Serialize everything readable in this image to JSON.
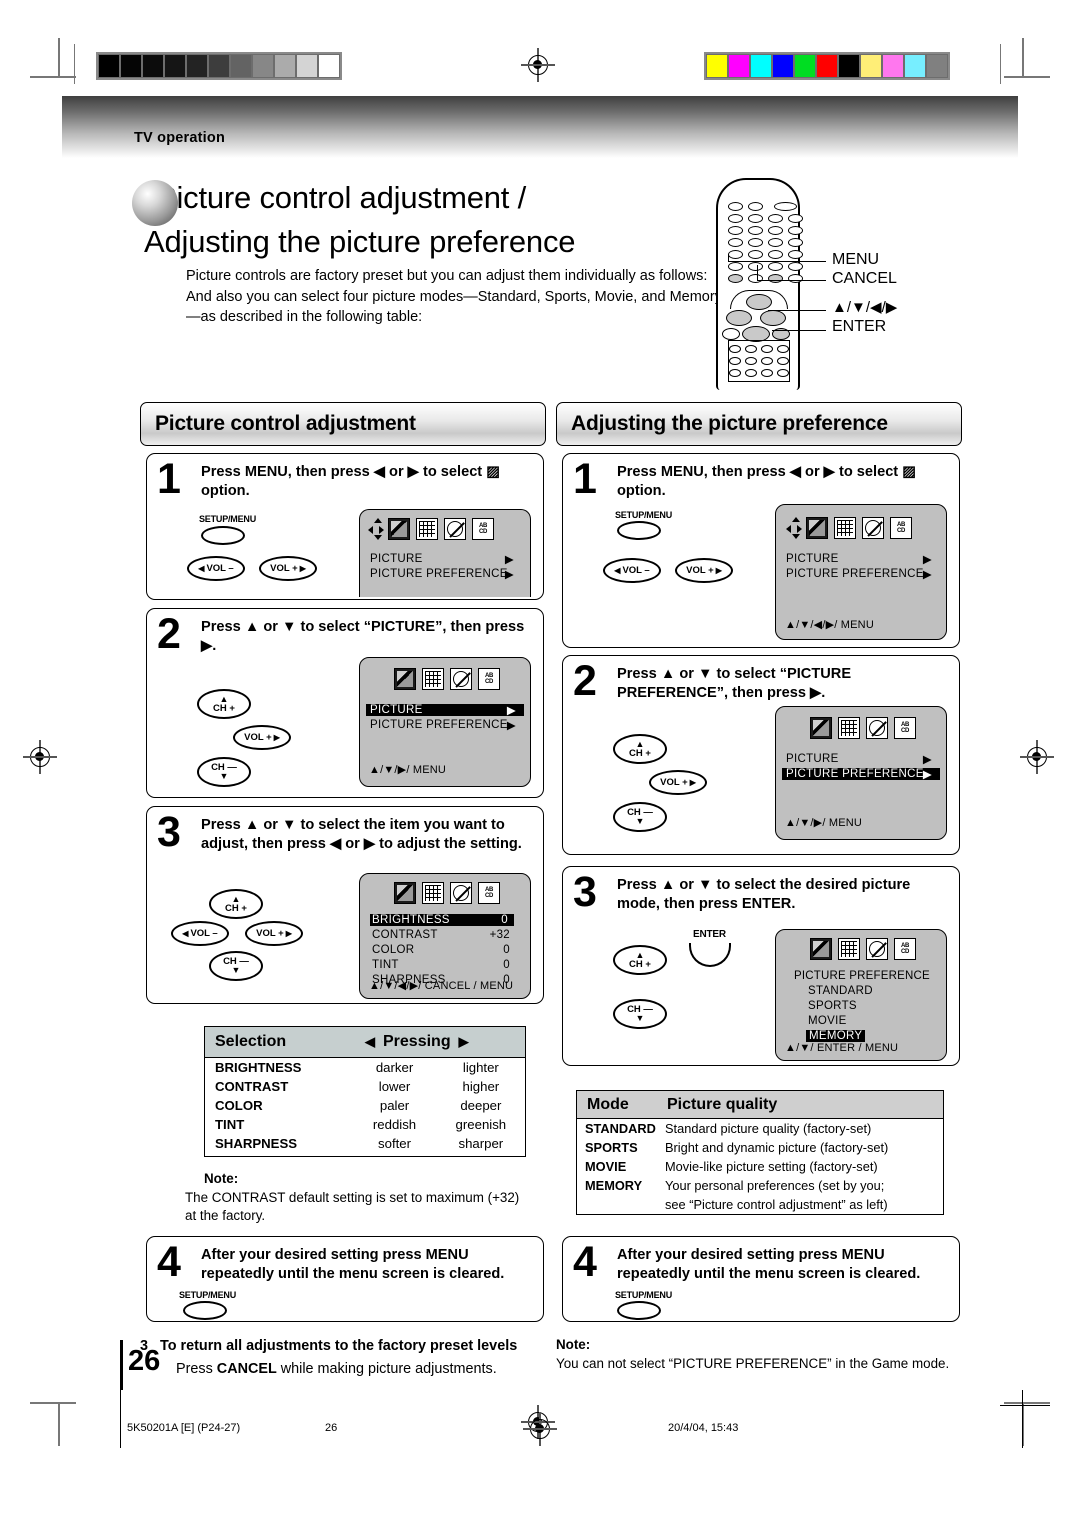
{
  "header": {
    "section_label": "TV operation"
  },
  "title": {
    "line1": "Picture control adjustment /",
    "line2": "Adjusting the picture preference"
  },
  "intro": "Picture controls are factory preset but you can adjust them individually as follows: And also you can select four picture modes—Standard, Sports, Movie, and Memory—as described in the following table:",
  "remote_callouts": {
    "menu": "MENU",
    "cancel": "CANCEL",
    "arrows": "▲/▼/◀/▶",
    "enter": "ENTER"
  },
  "left_column": {
    "heading": "Picture control adjustment",
    "step1": {
      "number": "1",
      "text": "Press MENU, then press ◀ or ▶ to select ▨ option.",
      "key_label": "SETUP/MENU",
      "key_vol_minus": "VOL –",
      "key_vol_plus": "VOL +",
      "osd": {
        "rows": [
          {
            "label": "PICTURE",
            "arrow": "▶",
            "highlight": false
          },
          {
            "label": "PICTURE  PREFERENCE",
            "arrow": "▶",
            "highlight": false
          }
        ],
        "footer": ""
      }
    },
    "step2": {
      "number": "2",
      "text": "Press ▲ or ▼ to select “PICTURE”, then press ▶.",
      "key_ch_plus": "CH +",
      "key_ch_minus": "CH —",
      "key_vol_plus": "VOL +",
      "osd": {
        "rows": [
          {
            "label": "PICTURE",
            "arrow": "▶",
            "highlight": true
          },
          {
            "label": "PICTURE  PREFERENCE",
            "arrow": "▶",
            "highlight": false
          }
        ],
        "footer": "▲/▼/▶/ MENU"
      }
    },
    "step3": {
      "number": "3",
      "text": "Press ▲ or ▼ to select the item you want to adjust, then press ◀ or ▶ to adjust the setting.",
      "key_ch_plus": "CH +",
      "key_ch_minus": "CH —",
      "key_vol_plus": "VOL +",
      "key_vol_minus": "VOL –",
      "osd": {
        "rows": [
          {
            "label": "BRIGHTNESS",
            "value": "0",
            "highlight": true
          },
          {
            "label": "CONTRAST",
            "value": "+32",
            "highlight": false
          },
          {
            "label": "COLOR",
            "value": "0",
            "highlight": false
          },
          {
            "label": "TINT",
            "value": "0",
            "highlight": false
          },
          {
            "label": "SHARPNESS",
            "value": "0",
            "highlight": false
          }
        ],
        "footer": "▲/▼/◀/▶/ CANCEL / MENU"
      }
    },
    "selection_table": {
      "header_selection": "Selection",
      "header_pressing_left": "◀",
      "header_pressing": "Pressing",
      "header_pressing_right": "▶",
      "rows": [
        {
          "selection": "BRIGHTNESS",
          "left": "darker",
          "right": "lighter"
        },
        {
          "selection": "CONTRAST",
          "left": "lower",
          "right": "higher"
        },
        {
          "selection": "COLOR",
          "left": "paler",
          "right": "deeper"
        },
        {
          "selection": "TINT",
          "left": "reddish",
          "right": "greenish"
        },
        {
          "selection": "SHARPNESS",
          "left": "softer",
          "right": "sharper"
        }
      ]
    },
    "note": {
      "title": "Note:",
      "body": "The CONTRAST default setting is set to maximum (+32) at the factory."
    },
    "step4": {
      "number": "4",
      "text": "After your desired setting press MENU repeatedly until the menu screen is cleared.",
      "key_label": "SETUP/MENU"
    },
    "footnote": {
      "number": "3",
      "heading": "To return all adjustments to the factory preset levels",
      "body_pre": "Press ",
      "body_bold": "CANCEL",
      "body_post": " while making picture adjustments."
    }
  },
  "right_column": {
    "heading": "Adjusting the picture preference",
    "step1": {
      "number": "1",
      "text": "Press MENU, then press ◀ or ▶ to select ▨ option.",
      "key_label": "SETUP/MENU",
      "key_vol_minus": "VOL –",
      "key_vol_plus": "VOL +",
      "osd": {
        "rows": [
          {
            "label": "PICTURE",
            "arrow": "▶",
            "highlight": false
          },
          {
            "label": "PICTURE  PREFERENCE",
            "arrow": "▶",
            "highlight": false
          }
        ],
        "footer": "▲/▼/◀/▶/ MENU"
      }
    },
    "step2": {
      "number": "2",
      "text": "Press ▲ or ▼ to select “PICTURE PREFERENCE”, then press ▶.",
      "key_ch_plus": "CH +",
      "key_ch_minus": "CH —",
      "key_vol_plus": "VOL +",
      "osd": {
        "rows": [
          {
            "label": "PICTURE",
            "arrow": "▶",
            "highlight": false
          },
          {
            "label": "PICTURE  PREFERENCE",
            "arrow": "▶",
            "highlight": true
          }
        ],
        "footer": "▲/▼/▶/ MENU"
      }
    },
    "step3": {
      "number": "3",
      "text": "Press ▲ or ▼ to select the desired picture mode, then press ENTER.",
      "key_ch_plus": "CH +",
      "key_ch_minus": "CH —",
      "key_enter": "ENTER",
      "osd": {
        "title": "PICTURE PREFERENCE",
        "items": [
          {
            "label": "STANDARD",
            "highlight": false
          },
          {
            "label": "SPORTS",
            "highlight": false
          },
          {
            "label": "MOVIE",
            "highlight": false
          },
          {
            "label": "MEMORY",
            "highlight": true
          }
        ],
        "footer": "▲/▼/ ENTER / MENU"
      }
    },
    "mode_table": {
      "header_mode": "Mode",
      "header_quality": "Picture quality",
      "rows": [
        {
          "mode": "STANDARD",
          "quality": "Standard picture quality (factory-set)"
        },
        {
          "mode": "SPORTS",
          "quality": "Bright and dynamic picture (factory-set)"
        },
        {
          "mode": "MOVIE",
          "quality": "Movie-like picture setting (factory-set)"
        },
        {
          "mode": "MEMORY",
          "quality": "Your personal preferences (set by you;"
        },
        {
          "mode": "",
          "quality": "see “Picture control adjustment” as left)"
        }
      ]
    },
    "step4": {
      "number": "4",
      "text": "After your desired setting press MENU repeatedly until the menu screen is cleared.",
      "key_label": "SETUP/MENU"
    },
    "note": {
      "title": "Note:",
      "body": "You can not select “PICTURE PREFERENCE” in the Game mode."
    }
  },
  "page_number": "26",
  "footer": {
    "doc_code": "5K50201A [E] (P24-27)",
    "page": "26",
    "date": "20/4/04, 15:43"
  },
  "swatches": {
    "gray": [
      "#000000",
      "#050505",
      "#0c0c0c",
      "#151515",
      "#232323",
      "#3d3d3d",
      "#636363",
      "#878787",
      "#ababab",
      "#d4d4d4",
      "#ffffff"
    ],
    "color": [
      "#ffff00",
      "#ff00ff",
      "#00ffff",
      "#0000ff",
      "#00dd22",
      "#ff0000",
      "#000000",
      "#ffee77",
      "#ff77ee",
      "#77eeff",
      "#808080"
    ]
  }
}
